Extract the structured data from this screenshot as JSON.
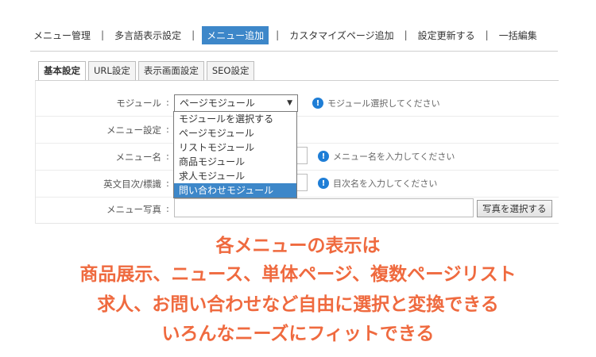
{
  "topnav": {
    "items": [
      "メニュー管理",
      "多言語表示設定",
      "メニュー追加",
      "カスタマイズページ追加",
      "設定更新する",
      "一括編集"
    ],
    "active_index": 2,
    "separator": "|"
  },
  "tabs": [
    "基本設定",
    "URL設定",
    "表示画面設定",
    "SEO設定"
  ],
  "form": {
    "colon": ":",
    "module": {
      "label": "モジュール",
      "selected": "ページモジュール",
      "hint": "モジュール選択してください"
    },
    "menu_setting": {
      "label": "メニュー設定"
    },
    "menu_name": {
      "label": "メニュー名",
      "hint": "メニュー名を入力してください"
    },
    "toc_title": {
      "label": "英文目次/標識",
      "hint": "目次名を入力してください"
    },
    "menu_photo": {
      "label": "メニュー写真",
      "button": "写真を選択する"
    }
  },
  "dropdown": {
    "options": [
      "モジュールを選択する",
      "ページモジュール",
      "リストモジュール",
      "商品モジュール",
      "求人モジュール",
      "問い合わせモジュール"
    ],
    "highlighted_index": 5
  },
  "caption": {
    "line1": "各メニューの表示は",
    "line2": "商品展示、ニュース、単体ページ、複数ページリスト",
    "line3": "求人、お問い合わせなど自由に選択と変換できる",
    "line4": "いろんなニーズにフィットできる"
  },
  "colors": {
    "accent": "#3d87c9",
    "info_icon": "#1f7ed6",
    "caption": "#ef6a3f"
  },
  "icons": {
    "info": "info-icon",
    "dropdown": "triangle-down-icon"
  }
}
